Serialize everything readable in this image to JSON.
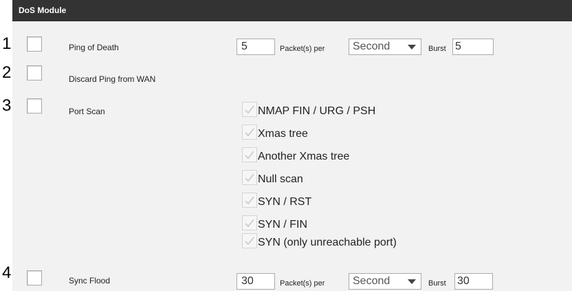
{
  "header": {
    "title": "DoS Module"
  },
  "rows": [
    {
      "number": "1",
      "label": "Ping of Death",
      "checked": false,
      "packets_value": "5",
      "packets_label": "Packet(s) per",
      "unit_selected": "Second",
      "burst_label": "Burst",
      "burst_value": "5"
    },
    {
      "number": "2",
      "label": "Discard Ping from WAN",
      "checked": false
    },
    {
      "number": "3",
      "label": "Port Scan",
      "checked": false
    },
    {
      "number": "4",
      "label": "Sync Flood",
      "checked": false,
      "packets_value": "30",
      "packets_label": "Packet(s) per",
      "unit_selected": "Second",
      "burst_label": "Burst",
      "burst_value": "30"
    }
  ],
  "port_scan_options": [
    {
      "label": "NMAP FIN / URG / PSH",
      "checked": true,
      "disabled": true
    },
    {
      "label": "Xmas tree",
      "checked": true,
      "disabled": true
    },
    {
      "label": "Another Xmas tree",
      "checked": true,
      "disabled": true
    },
    {
      "label": "Null scan",
      "checked": true,
      "disabled": true
    },
    {
      "label": "SYN / RST",
      "checked": true,
      "disabled": true
    },
    {
      "label": "SYN / FIN",
      "checked": true,
      "disabled": true
    },
    {
      "label": "SYN (only unreachable port)",
      "checked": true,
      "disabled": true
    }
  ],
  "colors": {
    "header_bg": "#333333",
    "panel_bg": "#f2f2f2",
    "disabled_check": "#cfcfcf"
  },
  "icons": {
    "disabled_checkmark": "checkmark-icon"
  }
}
